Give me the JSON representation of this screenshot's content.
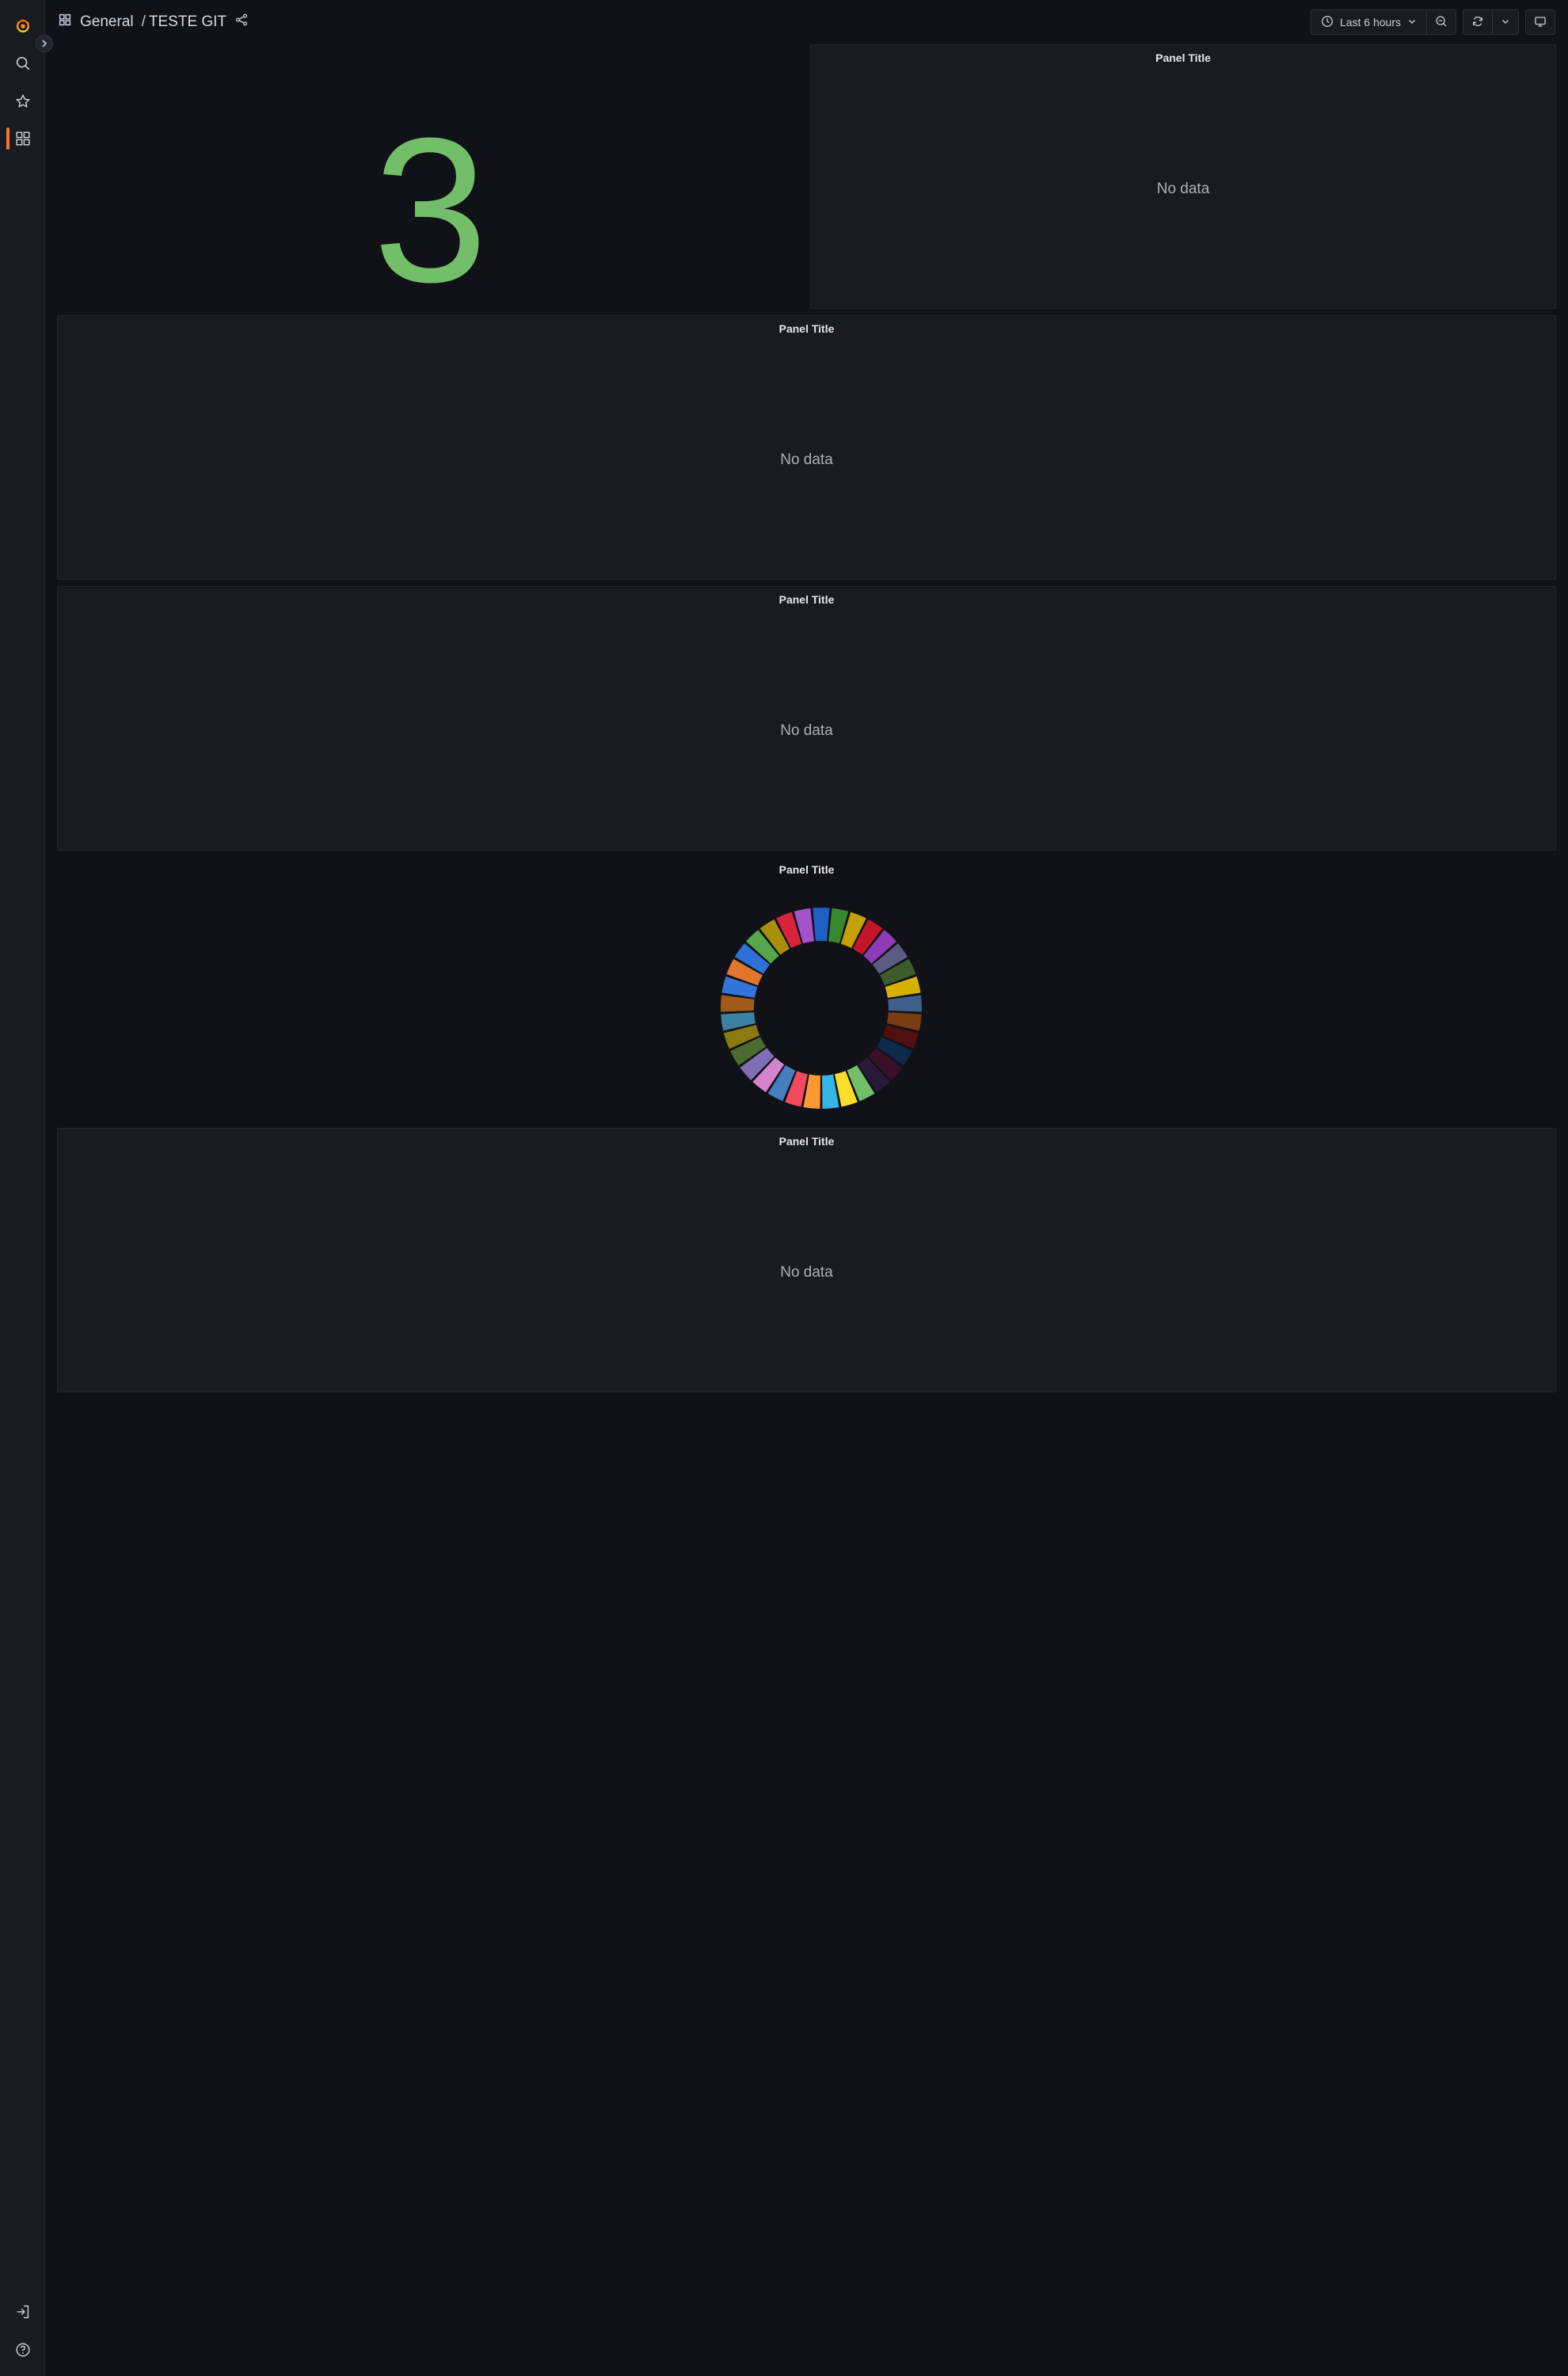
{
  "breadcrumb": {
    "folder": "General",
    "separator": "/",
    "dashboard": "TESTE GIT"
  },
  "toolbar": {
    "time_range": "Last 6 hours"
  },
  "icons": {
    "logo": "grafana-logo-icon",
    "search": "search-icon",
    "starred": "star-icon",
    "dashboards": "apps-icon",
    "signin": "sign-in-icon",
    "help": "help-icon",
    "share": "share-icon",
    "clock": "clock-icon",
    "zoom_out": "zoom-out-icon",
    "refresh": "sync-icon",
    "tv": "monitor-icon"
  },
  "colors": {
    "accent": "#ff7133",
    "stat_green": "#73bf69",
    "background": "#111217",
    "panel": "#181b1f"
  },
  "panels": {
    "stat": {
      "value": "3"
    },
    "top_right": {
      "title": "Panel Title",
      "message": "No data"
    },
    "row2": {
      "title": "Panel Title",
      "message": "No data"
    },
    "row3": {
      "title": "Panel Title",
      "message": "No data"
    },
    "donut": {
      "title": "Panel Title"
    },
    "row5": {
      "title": "Panel Title",
      "message": "No data"
    }
  },
  "chart_data": {
    "type": "pie",
    "donut": true,
    "slice_count": 33,
    "slices_equal": true,
    "colors": [
      "#1f60c4",
      "#37872d",
      "#c4a000",
      "#c4162a",
      "#8f3bb8",
      "#5a5a82",
      "#3e5c2a",
      "#d6b100",
      "#3d5f8a",
      "#7a3b12",
      "#4e1010",
      "#0e2a4a",
      "#3b0f28",
      "#2a1a3a",
      "#73bf69",
      "#fade2a",
      "#33b5e5",
      "#ff9830",
      "#f2495c",
      "#447ebc",
      "#d683ce",
      "#806eb7",
      "#4b6c2e",
      "#8a7a10",
      "#3d80a0",
      "#a05a1a",
      "#3274d9",
      "#e0752d",
      "#2f6fd8",
      "#56a64b",
      "#a8900a",
      "#d9233c",
      "#a352cc"
    ]
  }
}
